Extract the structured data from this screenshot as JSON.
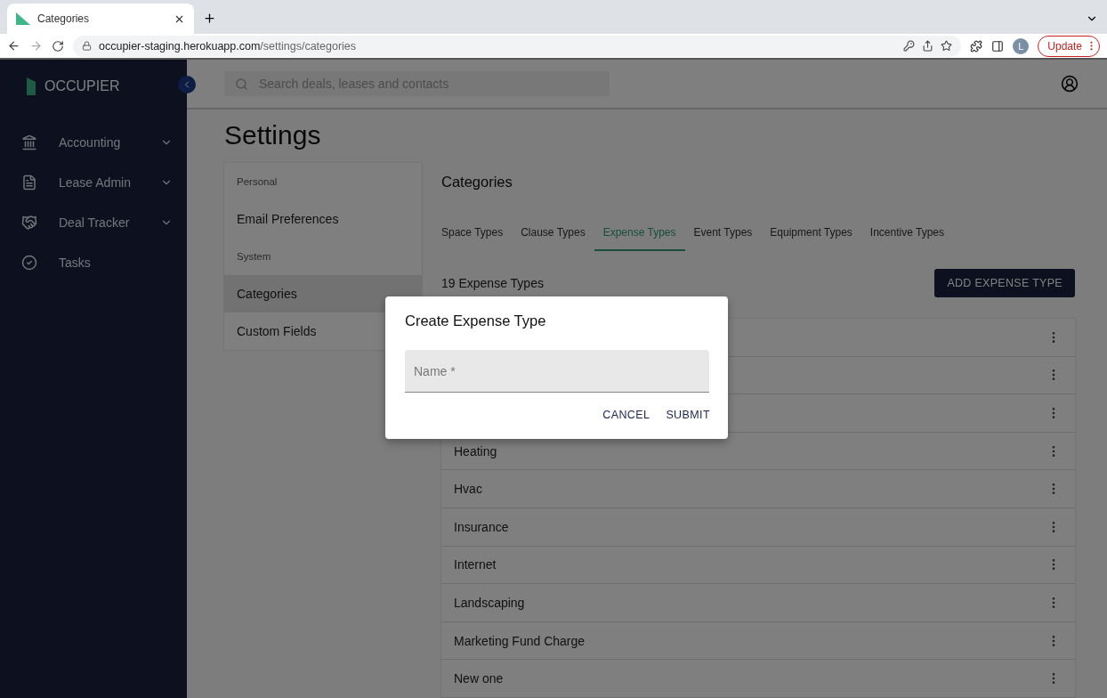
{
  "browser": {
    "tab": {
      "title": "Categories"
    },
    "url": {
      "host": "occupier-staging.herokuapp.com",
      "path": "/settings/categories"
    },
    "profile_initial": "L",
    "update_button": "Update"
  },
  "sidebar": {
    "brand": "OCCUPIER",
    "items": [
      {
        "label": "Accounting",
        "expandable": true
      },
      {
        "label": "Lease Admin",
        "expandable": true
      },
      {
        "label": "Deal Tracker",
        "expandable": true
      },
      {
        "label": "Tasks",
        "expandable": false
      }
    ]
  },
  "search": {
    "placeholder": "Search deals, leases and contacts"
  },
  "page_title": "Settings",
  "settings_nav": [
    {
      "kind": "header",
      "label": "Personal"
    },
    {
      "kind": "item",
      "label": "Email Preferences",
      "selected": false
    },
    {
      "kind": "header",
      "label": "System"
    },
    {
      "kind": "item",
      "label": "Categories",
      "selected": true
    },
    {
      "kind": "item",
      "label": "Custom Fields",
      "selected": false
    }
  ],
  "categories": {
    "title": "Categories",
    "tabs": [
      {
        "label": "Space Types",
        "selected": false
      },
      {
        "label": "Clause Types",
        "selected": false
      },
      {
        "label": "Expense Types",
        "selected": true
      },
      {
        "label": "Event Types",
        "selected": false
      },
      {
        "label": "Equipment Types",
        "selected": false
      },
      {
        "label": "Incentive Types",
        "selected": false
      }
    ],
    "count": "19 Expense Types",
    "add_button": "ADD EXPENSE TYPE",
    "rows": [
      {
        "kind": "covered"
      },
      {
        "kind": "covered"
      },
      {
        "kind": "covered"
      },
      {
        "kind": "named",
        "name": "Heating"
      },
      {
        "kind": "named",
        "name": "Hvac"
      },
      {
        "kind": "named",
        "name": "Insurance"
      },
      {
        "kind": "named",
        "name": "Internet"
      },
      {
        "kind": "named",
        "name": "Landscaping"
      },
      {
        "kind": "named",
        "name": "Marketing Fund Charge"
      },
      {
        "kind": "named",
        "name": "New one"
      }
    ]
  },
  "dialog": {
    "title": "Create Expense Type",
    "field": {
      "placeholder": "Name *"
    },
    "buttons": [
      "CANCEL",
      "SUBMIT"
    ]
  }
}
